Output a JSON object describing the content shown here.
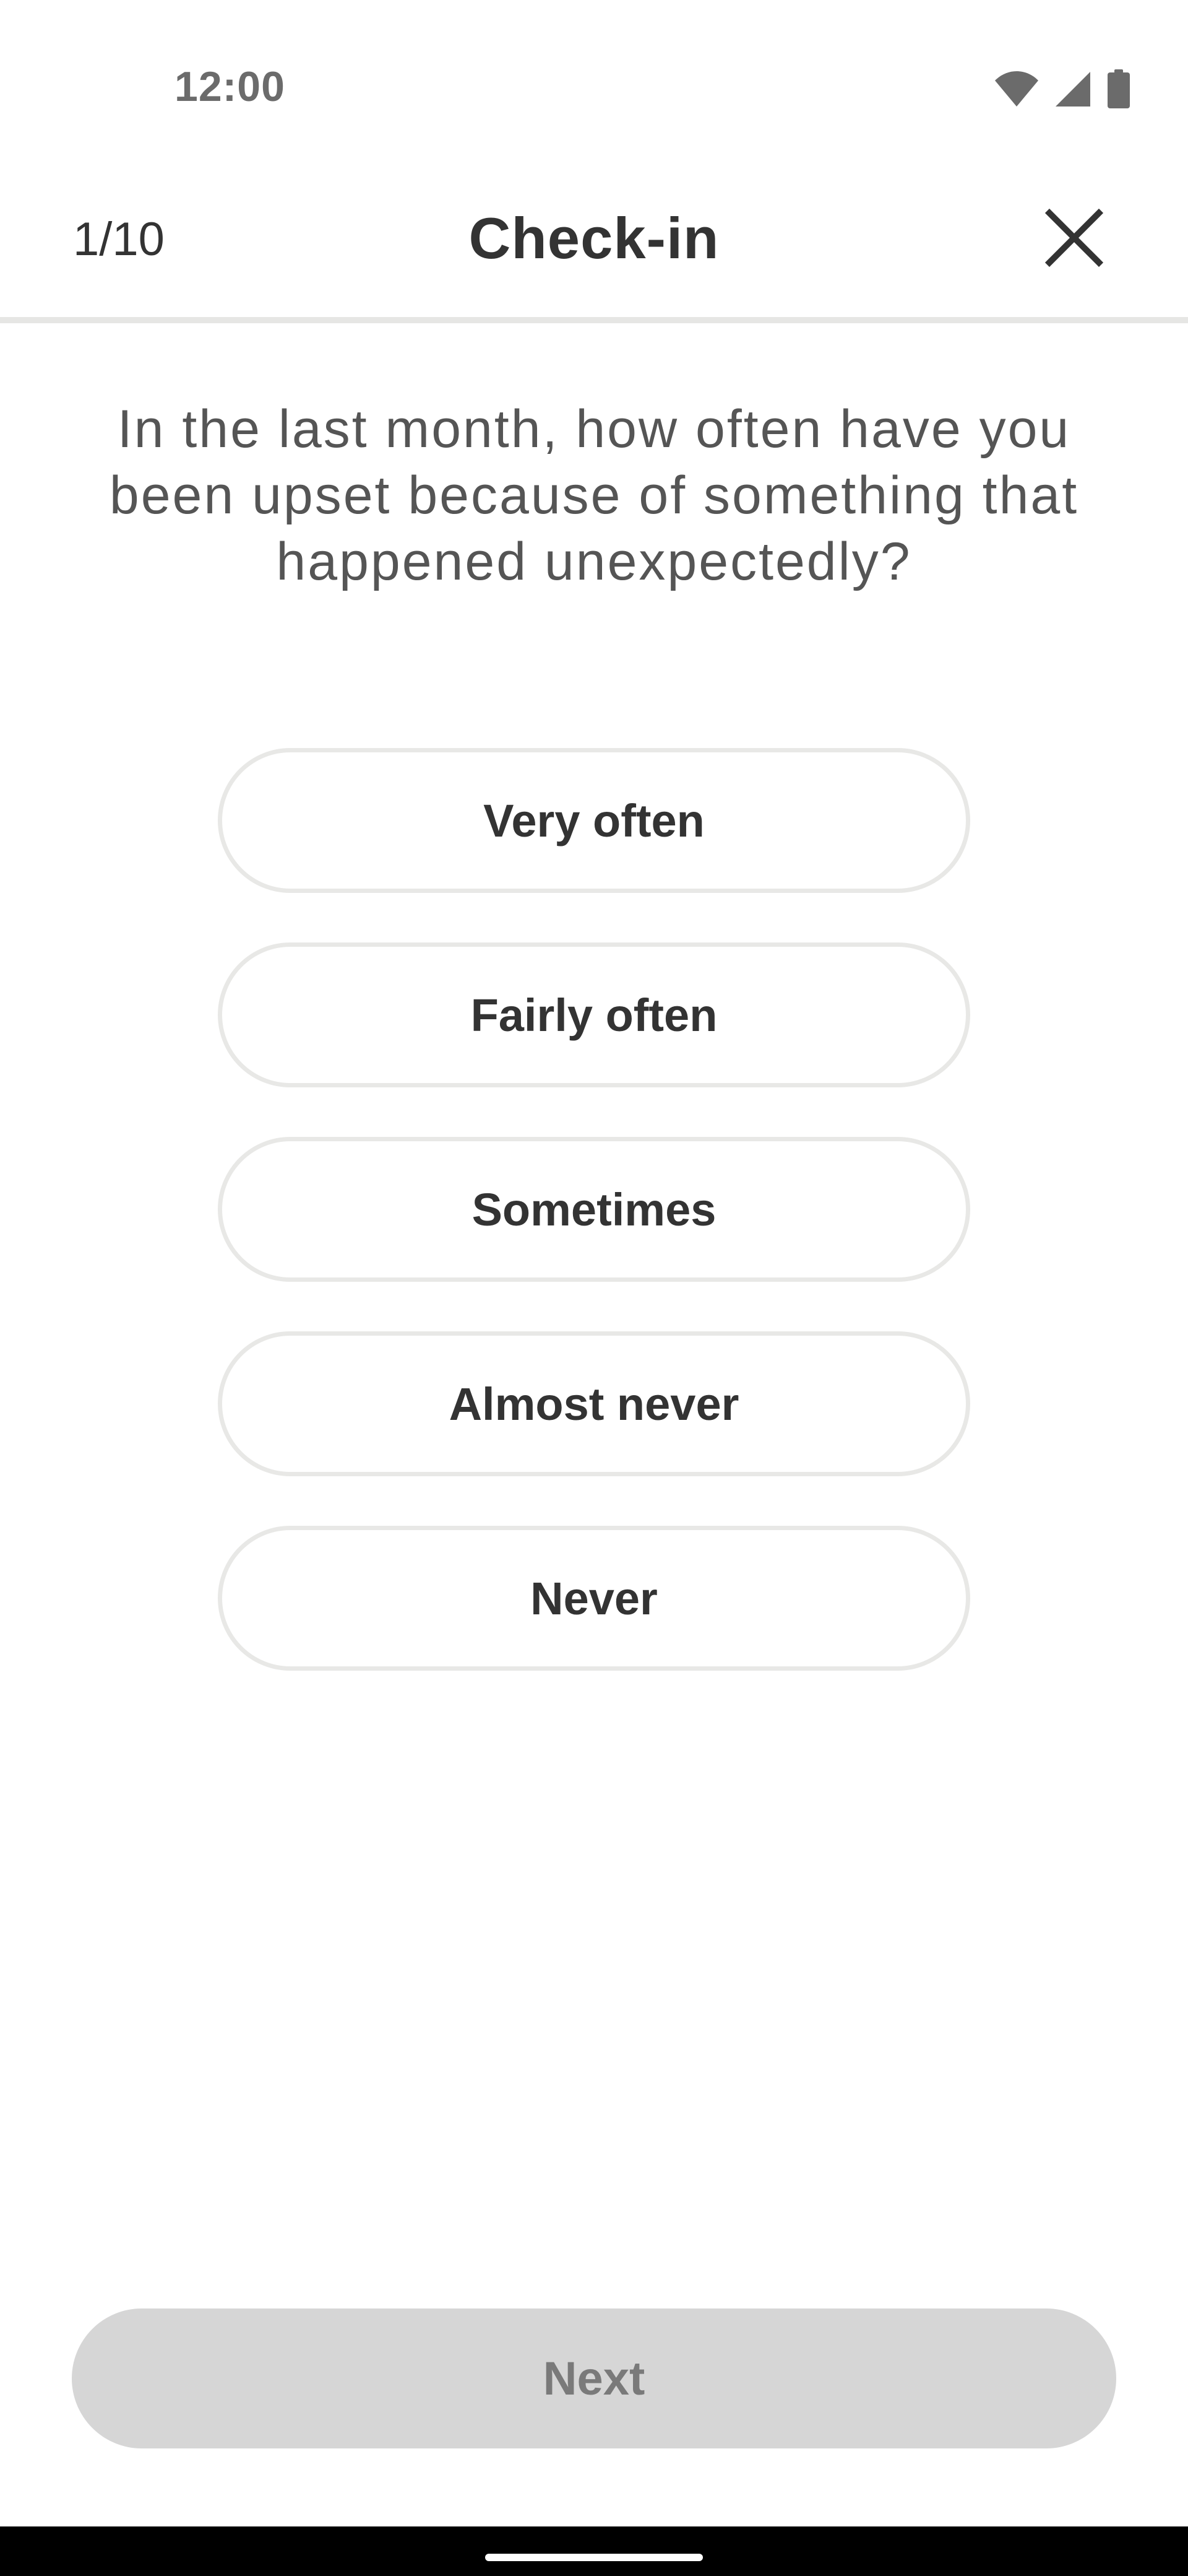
{
  "status_bar": {
    "time": "12:00",
    "icons": [
      "wifi-icon",
      "signal-icon",
      "battery-icon"
    ]
  },
  "header": {
    "progress": "1/10",
    "title": "Check-in",
    "close_icon": "close-icon"
  },
  "question": {
    "text": "In the last month, how often have you been upset because of something that happened unexpectedly?"
  },
  "options": [
    {
      "label": "Very often"
    },
    {
      "label": "Fairly often"
    },
    {
      "label": "Sometimes"
    },
    {
      "label": "Almost never"
    },
    {
      "label": "Never"
    }
  ],
  "footer": {
    "next_label": "Next",
    "next_enabled": false
  },
  "colors": {
    "text_primary": "#333333",
    "text_question": "#555555",
    "option_border": "#e8e8e6",
    "next_background_disabled": "#d6d6d6",
    "next_text_disabled": "#7a7a7a"
  }
}
